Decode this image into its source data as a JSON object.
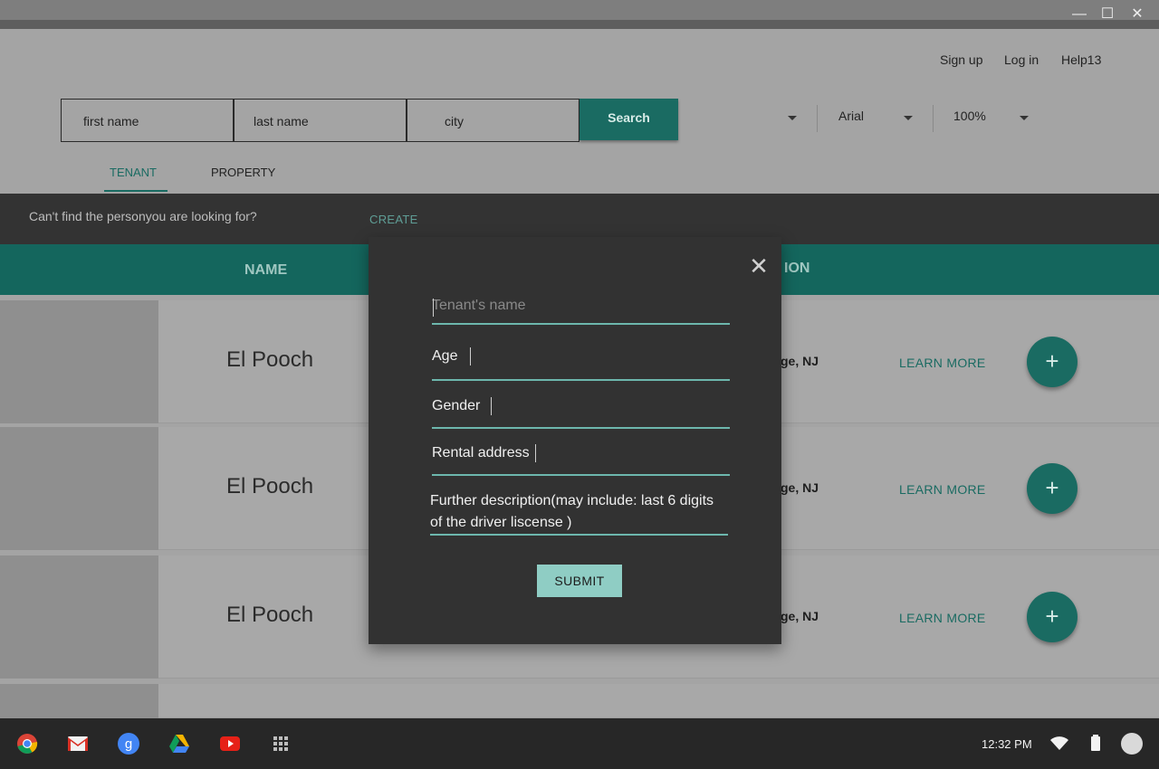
{
  "window": {
    "minimize_glyph": "—",
    "maximize_glyph": "☐",
    "close_glyph": "✕"
  },
  "header": {
    "links": {
      "signup": "Sign up",
      "login": "Log in",
      "help": "Help13"
    },
    "search": {
      "first_name_placeholder": "first name",
      "last_name_placeholder": "last name",
      "city_placeholder": "city",
      "button_label": "Search"
    },
    "font_select": "Arial",
    "zoom_select": "100%"
  },
  "tabs": [
    {
      "label": "TENANT",
      "active": true
    },
    {
      "label": "PROPERTY",
      "active": false
    }
  ],
  "notice": {
    "text": "Can't find the personyou are looking for?",
    "create_label": "CREATE"
  },
  "table": {
    "columns": {
      "name": "NAME",
      "location_partial": "ION"
    },
    "rows": [
      {
        "name": "El Pooch",
        "location_partial": "ge, NJ",
        "learn_more": "LEARN MORE",
        "add_glyph": "+"
      },
      {
        "name": "El Pooch",
        "location_partial": "ge, NJ",
        "learn_more": "LEARN MORE",
        "add_glyph": "+"
      },
      {
        "name": "El Pooch",
        "location_partial": "ge, NJ",
        "learn_more": "LEARN MORE",
        "add_glyph": "+"
      }
    ]
  },
  "modal": {
    "close_glyph": "✕",
    "fields": {
      "tenant_name_placeholder": "Tenant's name",
      "age": "Age",
      "gender": "Gender",
      "rental_address": "Rental address",
      "description": "Further description(may include: last 6 digits of the driver liscense )"
    },
    "submit_label": "SUBMIT"
  },
  "taskbar": {
    "apps": [
      "chrome-icon",
      "gmail-icon",
      "google-search-icon",
      "drive-icon",
      "youtube-icon",
      "launcher-icon"
    ],
    "time": "12:32 PM"
  },
  "colors": {
    "accent": "#1a6b62",
    "header_band": "#14665d",
    "modal_bg": "#323232",
    "field_underline": "#6db7ad",
    "submit_bg": "#8fcdc4"
  }
}
